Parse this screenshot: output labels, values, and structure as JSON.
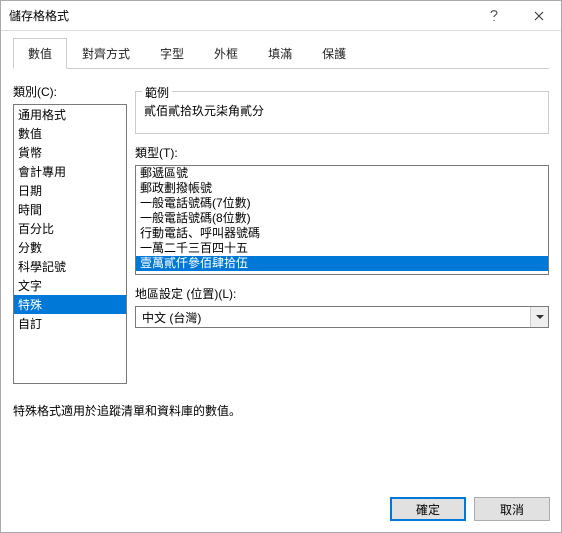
{
  "window": {
    "title": "儲存格格式"
  },
  "tabs": [
    {
      "label": "數值"
    },
    {
      "label": "對齊方式"
    },
    {
      "label": "字型"
    },
    {
      "label": "外框"
    },
    {
      "label": "填滿"
    },
    {
      "label": "保護"
    }
  ],
  "active_tab": 0,
  "category": {
    "label": "類別(C):",
    "items": [
      "通用格式",
      "數值",
      "貨幣",
      "會計專用",
      "日期",
      "時間",
      "百分比",
      "分數",
      "科學記號",
      "文字",
      "特殊",
      "自訂"
    ],
    "selected": 10
  },
  "sample": {
    "label": "範例",
    "value": "貳佰貳拾玖元柒角貳分"
  },
  "type": {
    "label": "類型(T):",
    "items": [
      "郵遞區號",
      "郵政劃撥帳號",
      "一般電話號碼(7位數)",
      "一般電話號碼(8位數)",
      "行動電話、呼叫器號碼",
      "一萬二千三百四十五",
      "壹萬貳仟參佰肆拾伍"
    ],
    "selected": 6
  },
  "locale": {
    "label": "地區設定 (位置)(L):",
    "value": "中文 (台灣)"
  },
  "description": "特殊格式適用於追蹤清單和資料庫的數值。",
  "buttons": {
    "ok": "確定",
    "cancel": "取消"
  }
}
